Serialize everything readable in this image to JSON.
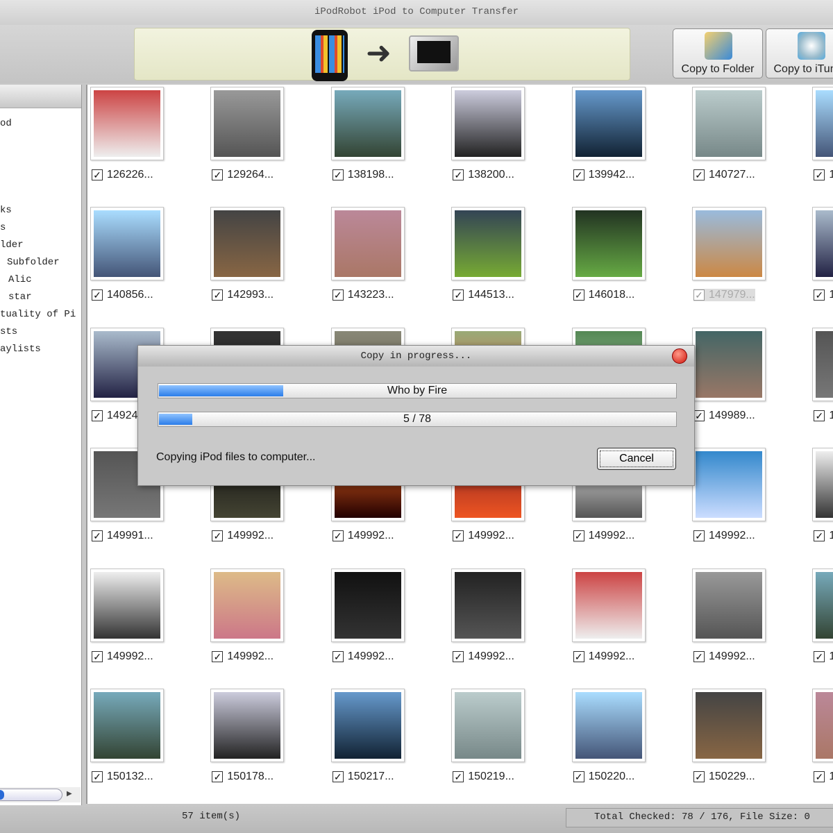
{
  "window": {
    "title": "iPodRobot iPod to Computer Transfer"
  },
  "toolbar": {
    "copy_to_folder": "Copy to Folder",
    "copy_to_itunes": "Copy to iTunes"
  },
  "sidebar": {
    "items": [
      "od",
      "ks",
      "s",
      "lder",
      "Subfolder",
      "Alic",
      "star",
      "tuality of Pi",
      "sts",
      "aylists"
    ]
  },
  "grid": {
    "rows": [
      [
        "126226...",
        "129264...",
        "138198...",
        "138200...",
        "139942...",
        "140727...",
        "1"
      ],
      [
        "140856...",
        "142993...",
        "143223...",
        "144513...",
        "146018...",
        "147979...",
        "1"
      ],
      [
        "14924",
        "",
        "",
        "",
        "",
        "149989...",
        "1"
      ],
      [
        "149991...",
        "149992...",
        "149992...",
        "149992...",
        "149992...",
        "149992...",
        "1"
      ],
      [
        "149992...",
        "149992...",
        "149992...",
        "149992...",
        "149992...",
        "149992...",
        "1"
      ],
      [
        "150132...",
        "150178...",
        "150217...",
        "150219...",
        "150220...",
        "150229...",
        "1"
      ]
    ],
    "disabled_item": "147979..."
  },
  "dialog": {
    "title": "Copy in progress...",
    "track": "Who by Fire",
    "track_progress": 0.24,
    "count": "5 / 78",
    "count_progress": 0.064,
    "message": "Copying iPod files to computer...",
    "cancel": "Cancel"
  },
  "status": {
    "items": "57 item(s)",
    "checked": "Total Checked: 78 / 176, File Size: 0"
  },
  "colors": {
    "progress": "#2b7de9",
    "banner": "#eceed4"
  }
}
